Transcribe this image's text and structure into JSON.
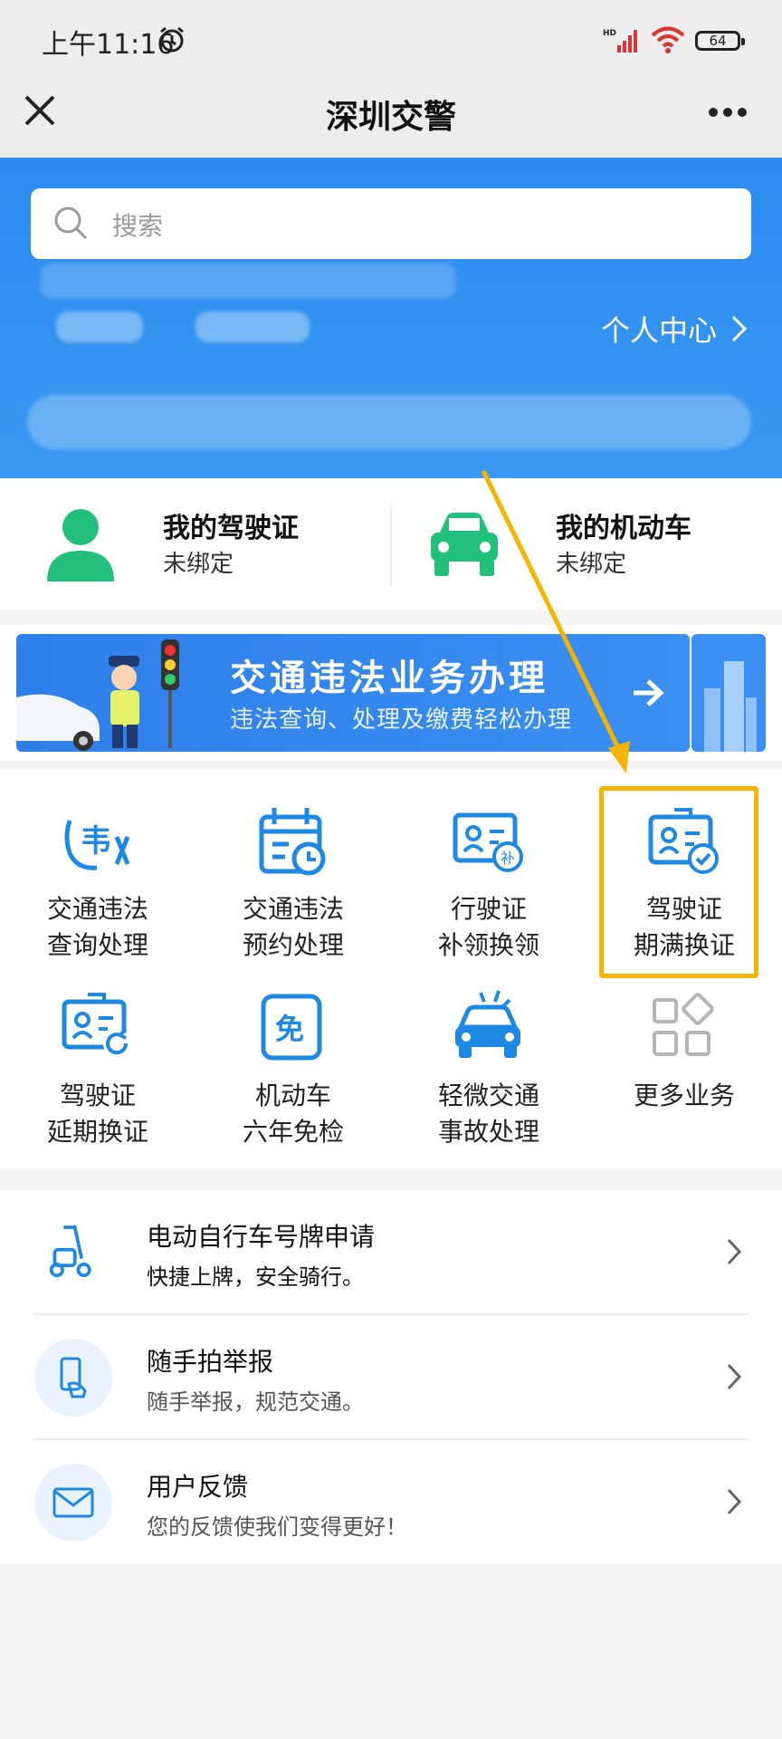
{
  "status_bar": {
    "time": "上午11:16",
    "battery": "64"
  },
  "navbar": {
    "title": "深圳交警"
  },
  "search": {
    "placeholder": "搜索"
  },
  "header": {
    "personal_center": "个人中心"
  },
  "cards": [
    {
      "title": "我的驾驶证",
      "status": "未绑定"
    },
    {
      "title": "我的机动车",
      "status": "未绑定"
    }
  ],
  "banner": {
    "title": "交通违法业务办理",
    "subtitle": "违法查询、处理及缴费轻松办理"
  },
  "services": [
    {
      "line1": "交通违法",
      "line2": "查询处理",
      "icon": "violation-icon"
    },
    {
      "line1": "交通违法",
      "line2": "预约处理",
      "icon": "calendar-icon"
    },
    {
      "line1": "行驶证",
      "line2": "补领换领",
      "icon": "id-card-plus-icon"
    },
    {
      "line1": "驾驶证",
      "line2": "期满换证",
      "icon": "id-card-check-icon"
    },
    {
      "line1": "驾驶证",
      "line2": "延期换证",
      "icon": "id-card-refresh-icon"
    },
    {
      "line1": "机动车",
      "line2": "六年免检",
      "icon": "exempt-icon"
    },
    {
      "line1": "轻微交通",
      "line2": "事故处理",
      "icon": "car-accident-icon"
    },
    {
      "line1": "更多业务",
      "line2": "",
      "icon": "grid-more-icon"
    }
  ],
  "list": [
    {
      "title": "电动自行车号牌申请",
      "subtitle": "快捷上牌，安全骑行。",
      "icon": "scooter-icon"
    },
    {
      "title": "随手拍举报",
      "subtitle": "随手举报，规范交通。",
      "icon": "phone-report-icon"
    },
    {
      "title": "用户反馈",
      "subtitle": "您的反馈使我们变得更好！",
      "icon": "mail-icon"
    }
  ],
  "colors": {
    "brand_blue": "#2c8cf0",
    "icon_blue": "#1e88e5",
    "green": "#22c07a",
    "highlight": "#f5b400"
  }
}
